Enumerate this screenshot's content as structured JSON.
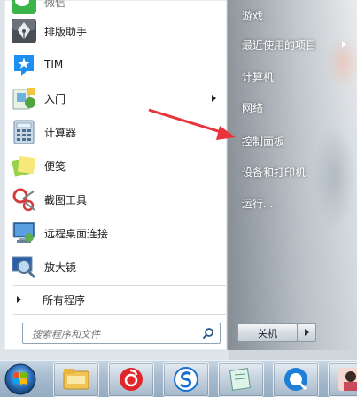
{
  "start_menu": {
    "programs": [
      {
        "label": "微信"
      },
      {
        "label": "排版助手"
      },
      {
        "label": "TIM"
      },
      {
        "label": "入门"
      },
      {
        "label": "计算器"
      },
      {
        "label": "便笺"
      },
      {
        "label": "截图工具"
      },
      {
        "label": "远程桌面连接"
      },
      {
        "label": "放大镜"
      }
    ],
    "all_programs": "所有程序",
    "search_placeholder": "搜索程序和文件",
    "right_items": [
      {
        "label": "游戏"
      },
      {
        "label": "最近使用的项目"
      },
      {
        "label": "计算机"
      },
      {
        "label": "网络"
      },
      {
        "label": "控制面板"
      },
      {
        "label": "设备和打印机"
      },
      {
        "label": "运行..."
      }
    ],
    "shutdown_label": "关机"
  },
  "colors": {
    "annotation_arrow": "#e8343a",
    "taskbar": "#a9bdd0"
  },
  "taskbar": {
    "items": [
      {
        "icon": "file-explorer-icon"
      },
      {
        "icon": "netease-music-icon"
      },
      {
        "icon": "sogou-input-icon"
      },
      {
        "icon": "notes-icon"
      },
      {
        "icon": "qq-browser-icon"
      },
      {
        "icon": "user-avatar-icon"
      }
    ]
  }
}
